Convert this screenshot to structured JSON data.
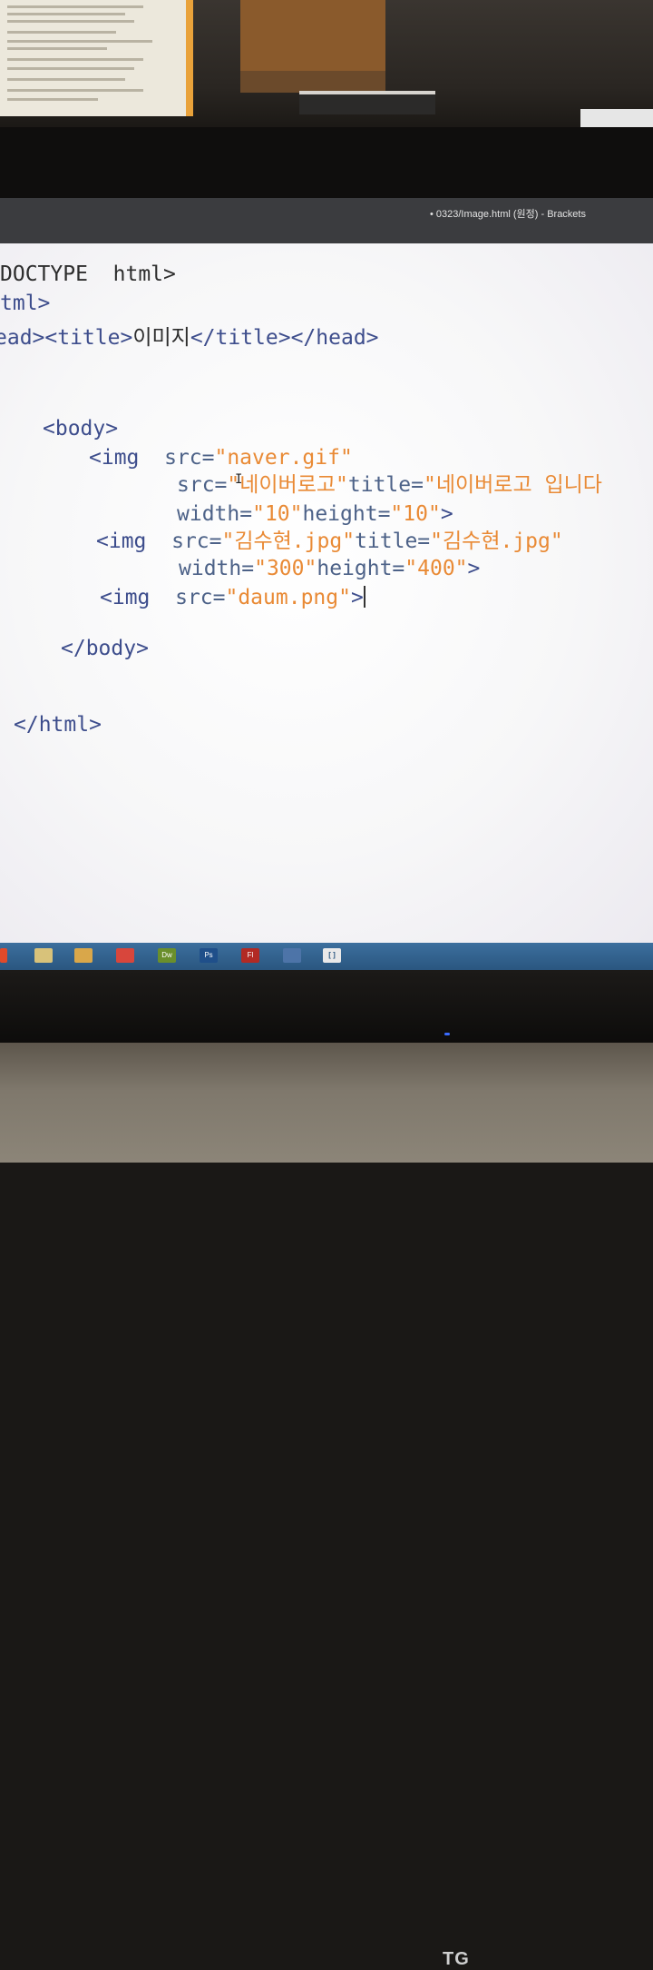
{
  "window": {
    "title": "• 0323/Image.html (원정) - Brackets"
  },
  "code": [
    [
      {
        "c": "txt",
        "t": "DOCTYPE  html>"
      }
    ],
    [
      {
        "c": "tag",
        "t": "tml>"
      }
    ],
    [
      {
        "c": "tag",
        "t": "ead><title>"
      },
      {
        "c": "txt",
        "t": "이미지"
      },
      {
        "c": "tag",
        "t": "</title></head>"
      }
    ],
    [],
    [],
    [
      {
        "c": "tag",
        "t": "<body>"
      }
    ],
    [
      {
        "c": "tag",
        "t": "<img"
      },
      {
        "c": "txt",
        "t": "  "
      },
      {
        "c": "attr",
        "t": "src="
      },
      {
        "c": "val",
        "t": "\"naver.gif\""
      }
    ],
    [
      {
        "c": "attr",
        "t": "src="
      },
      {
        "c": "val",
        "t": "\"네이버로고\""
      },
      {
        "c": "attr",
        "t": "title="
      },
      {
        "c": "val",
        "t": "\"네이버로고 입니다"
      }
    ],
    [
      {
        "c": "attr",
        "t": "width="
      },
      {
        "c": "val",
        "t": "\"10\""
      },
      {
        "c": "attr",
        "t": "height="
      },
      {
        "c": "val",
        "t": "\"10\""
      },
      {
        "c": "tag",
        "t": ">"
      }
    ],
    [
      {
        "c": "tag",
        "t": "<img"
      },
      {
        "c": "txt",
        "t": "  "
      },
      {
        "c": "attr",
        "t": "src="
      },
      {
        "c": "val",
        "t": "\"김수현.jpg\""
      },
      {
        "c": "attr",
        "t": "title="
      },
      {
        "c": "val",
        "t": "\"김수현.jpg\""
      }
    ],
    [
      {
        "c": "attr",
        "t": "width="
      },
      {
        "c": "val",
        "t": "\"300\""
      },
      {
        "c": "attr",
        "t": "height="
      },
      {
        "c": "val",
        "t": "\"400\""
      },
      {
        "c": "tag",
        "t": ">"
      }
    ],
    [
      {
        "c": "tag",
        "t": "<img"
      },
      {
        "c": "txt",
        "t": "  "
      },
      {
        "c": "attr",
        "t": "src="
      },
      {
        "c": "val",
        "t": "\"daum.png\""
      },
      {
        "c": "tag",
        "t": ">"
      }
    ],
    [],
    [
      {
        "c": "tag",
        "t": "</body>"
      }
    ],
    [],
    [],
    [
      {
        "c": "tag",
        "t": "</html>"
      }
    ]
  ],
  "taskbar": {
    "items": [
      {
        "name": "explorer-icon",
        "label": "",
        "color": "#d8c27a"
      },
      {
        "name": "folder-icon",
        "label": "",
        "color": "#d9a74a"
      },
      {
        "name": "browser-icon",
        "label": "",
        "color": "#d8463c"
      },
      {
        "name": "dreamweaver-icon",
        "label": "Dw",
        "color": "#6a8f2c"
      },
      {
        "name": "photoshop-icon",
        "label": "Ps",
        "color": "#1f4f8a"
      },
      {
        "name": "flash-icon",
        "label": "Fl",
        "color": "#b22a24"
      },
      {
        "name": "link-icon",
        "label": "",
        "color": "#4d74a8"
      },
      {
        "name": "brackets-icon",
        "label": "[ ]",
        "color": "#e9e9e9"
      }
    ]
  },
  "monitor": {
    "brand": "TG"
  }
}
